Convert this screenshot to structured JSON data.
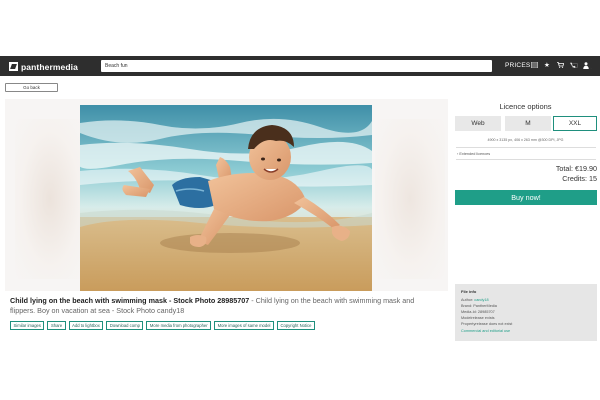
{
  "header": {
    "logo_text": "panthermedia",
    "search_value": "Beach fun",
    "prices_label": "PRICES",
    "icons": [
      "grid-icon",
      "star-icon",
      "cart-icon",
      "phone-icon",
      "user-icon"
    ]
  },
  "nav": {
    "go_back_label": "Go back"
  },
  "photo": {
    "title": "Child lying on the beach with swimming mask - Stock Photo 28985707",
    "description": " - Child lying on the beach with swimming mask and flippers. Boy on vacation at sea - Stock Photo candy18"
  },
  "actions": [
    "Similar images",
    "Share",
    "Add to lightbox",
    "Download comp",
    "More media from photographer",
    "More images of same model",
    "Copyright Notice"
  ],
  "licence": {
    "title": "Licence options",
    "sizes": [
      "Web",
      "M",
      "XXL"
    ],
    "selected_size": "XXL",
    "dimensions": "4900 x 3135 px, 406 x 263 mm @300 DPI, JPG",
    "extended": "Extended licences",
    "total": "Total: €19.90",
    "credits": "Credits: 15",
    "buy_label": "Buy now!"
  },
  "file_info": {
    "title": "File info",
    "author_label": "Author: ",
    "author_value": "candy18",
    "brand": "Brand: PantherMedia",
    "media_id": "Media-Id: 28985707",
    "model_release": "Modelrelease exists",
    "property_release": "Propertyrelease does not exist",
    "usage": "Commercial and editorial use"
  },
  "colors": {
    "accent": "#1f9e88",
    "topbar": "#2e2e2e"
  }
}
